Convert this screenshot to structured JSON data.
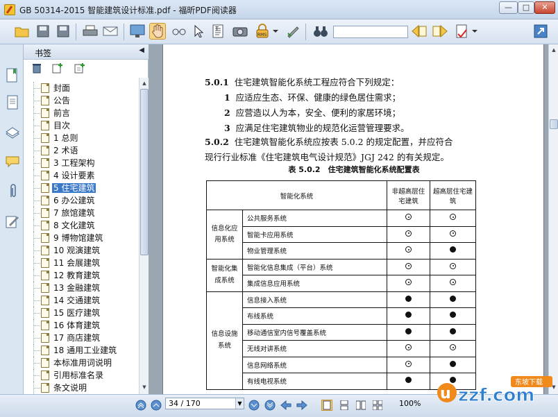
{
  "window": {
    "title": "GB 50314-2015 智能建筑设计标准.pdf - 福昕PDF阅读器",
    "min": "—",
    "max": "□",
    "close": "✕"
  },
  "toolbar": {
    "search_value": ""
  },
  "panel": {
    "title": "书签",
    "collapse": "◀",
    "bookmarks": [
      {
        "label": "封面"
      },
      {
        "label": "公告"
      },
      {
        "label": "前言"
      },
      {
        "label": "目次"
      },
      {
        "label": "1 总则"
      },
      {
        "label": "2 术语"
      },
      {
        "label": "3 工程架构"
      },
      {
        "label": "4 设计要素"
      },
      {
        "label": "5 住宅建筑"
      },
      {
        "label": "6 办公建筑"
      },
      {
        "label": "7 旅馆建筑"
      },
      {
        "label": "8 文化建筑"
      },
      {
        "label": "9 博物馆建筑"
      },
      {
        "label": "10 观演建筑"
      },
      {
        "label": "11 会展建筑"
      },
      {
        "label": "12 教育建筑"
      },
      {
        "label": "13 金融建筑"
      },
      {
        "label": "14 交通建筑"
      },
      {
        "label": "15 医疗建筑"
      },
      {
        "label": "16 体育建筑"
      },
      {
        "label": "17 商店建筑"
      },
      {
        "label": "18 通用工业建筑"
      },
      {
        "label": "本标准用词说明"
      },
      {
        "label": "引用标准名录"
      },
      {
        "label": "条文说明"
      }
    ],
    "selected_index": 8
  },
  "document": {
    "l1_num": "5.0.1",
    "l1": "住宅建筑智能化系统工程应符合下列规定：",
    "l2_num": "1",
    "l2": "应适应生态、环保、健康的绿色居住需求；",
    "l3_num": "2",
    "l3": "应营造以人为本，安全、便利的家居环境；",
    "l4_num": "3",
    "l4": "应满足住宅建筑物业的规范化运营管理要求。",
    "l5_num": "5.0.2",
    "l5": "住宅建筑智能化系统应按表 5.0.2 的规定配置，并应符合",
    "l6": "现行行业标准《住宅建筑电气设计规范》JGJ 242 的有关规定。",
    "table_title": "表 5.0.2　住宅建筑智能化系统配置表",
    "table": {
      "head_system": "智能化系统",
      "head_col1": "非超高层住宅建筑",
      "head_col2": "超高层住宅建筑",
      "groups": [
        {
          "name": "信息化应用系统",
          "rows": [
            {
              "item": "公共服务系统",
              "c1": "open",
              "c2": "open"
            },
            {
              "item": "智能卡应用系统",
              "c1": "open",
              "c2": "open"
            },
            {
              "item": "物业管理系统",
              "c1": "open",
              "c2": "full"
            }
          ]
        },
        {
          "name": "智能化集成系统",
          "rows": [
            {
              "item": "智能化信息集成（平台）系统",
              "c1": "open",
              "c2": "open"
            },
            {
              "item": "集成信息应用系统",
              "c1": "open",
              "c2": "open"
            }
          ]
        },
        {
          "name": "信息设施系统",
          "rows": [
            {
              "item": "信息接入系统",
              "c1": "full",
              "c2": "full"
            },
            {
              "item": "布线系统",
              "c1": "full",
              "c2": "full"
            },
            {
              "item": "移动通信室内信号覆盖系统",
              "c1": "full",
              "c2": "full"
            },
            {
              "item": "无线对讲系统",
              "c1": "open",
              "c2": "open"
            },
            {
              "item": "信息网络系统",
              "c1": "open",
              "c2": "full"
            },
            {
              "item": "有线电视系统",
              "c1": "full",
              "c2": "full"
            }
          ]
        }
      ]
    }
  },
  "status": {
    "page_value": "34 / 170",
    "dropdown": "▼",
    "zoom": "100%"
  },
  "watermark": {
    "text": "uzzf.com",
    "badge": "东坡下载"
  },
  "colors": {
    "accent": "#3a78c9",
    "titlebar": "#c5d6ea",
    "doc_bg": "#9aa6b2"
  }
}
